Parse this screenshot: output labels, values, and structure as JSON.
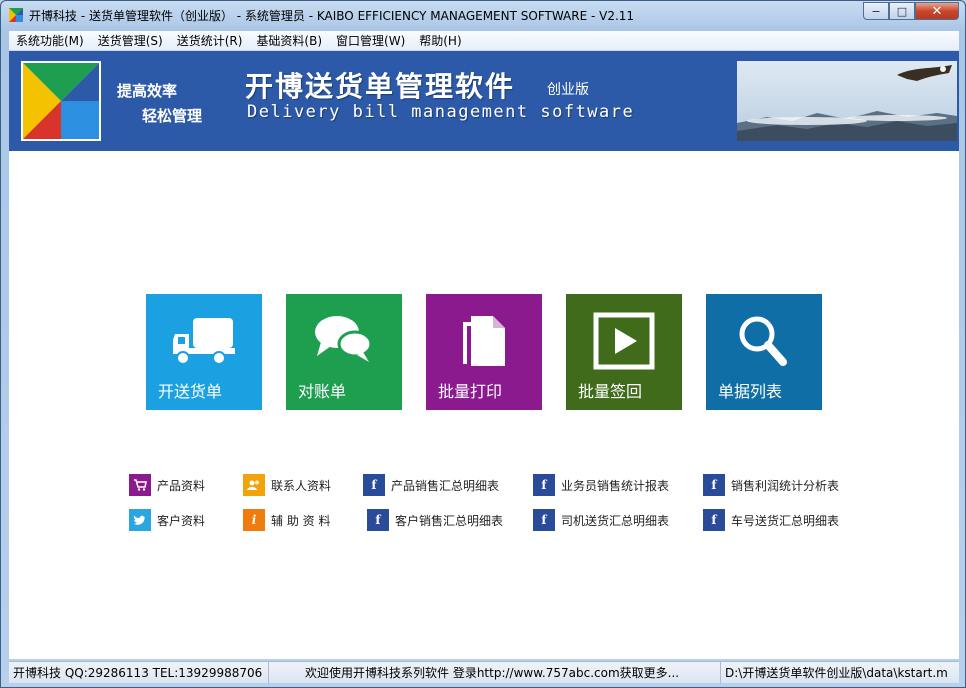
{
  "window": {
    "title": "开博科技 - 送货单管理软件（创业版） - 系统管理员 - KAIBO EFFICIENCY MANAGEMENT SOFTWARE - V2.11",
    "minimize_label": "−",
    "maximize_label": "□",
    "close_label": "✕"
  },
  "menu": [
    {
      "label": "系统功能(M)"
    },
    {
      "label": "送货管理(S)"
    },
    {
      "label": "送货统计(R)"
    },
    {
      "label": "基础资料(B)"
    },
    {
      "label": "窗口管理(W)"
    },
    {
      "label": "帮助(H)"
    }
  ],
  "banner": {
    "slogan_line1": "提高效率",
    "slogan_line2": "轻松管理",
    "title": "开博送货单管理软件",
    "edition": "创业版",
    "subtitle": "Delivery bill management software"
  },
  "tiles": [
    {
      "label": "开送货单",
      "color": "#1ba1e2",
      "icon": "truck-icon"
    },
    {
      "label": "对账单",
      "color": "#1e9e4f",
      "icon": "chat-bubbles-icon"
    },
    {
      "label": "批量打印",
      "color": "#8b1a8f",
      "icon": "documents-icon"
    },
    {
      "label": "批量签回",
      "color": "#3f6b1a",
      "icon": "play-icon"
    },
    {
      "label": "单据列表",
      "color": "#0f6ea6",
      "icon": "magnifier-icon"
    }
  ],
  "links": [
    {
      "label": "产品资料",
      "icon": "cart-icon",
      "color": "#8b1a8f"
    },
    {
      "label": "联系人资料",
      "icon": "contacts-icon",
      "color": "#f0a30a"
    },
    {
      "label": "产品销售汇总明细表",
      "icon": "facebook-icon",
      "color": "#2a4a9a"
    },
    {
      "label": "业务员销售统计报表",
      "icon": "facebook-icon",
      "color": "#2a4a9a"
    },
    {
      "label": "销售利润统计分析表",
      "icon": "facebook-icon",
      "color": "#2a4a9a"
    },
    {
      "label": "客户资料",
      "icon": "twitter-icon",
      "color": "#2ba6e1"
    },
    {
      "label": "辅 助 资 料",
      "icon": "info-icon",
      "color": "#f07c10"
    },
    {
      "label": "客户销售汇总明细表",
      "icon": "facebook-icon",
      "color": "#2a4a9a"
    },
    {
      "label": "司机送货汇总明细表",
      "icon": "facebook-icon",
      "color": "#2a4a9a"
    },
    {
      "label": "车号送货汇总明细表",
      "icon": "facebook-icon",
      "color": "#2a4a9a"
    }
  ],
  "status": {
    "company": "开博科技 QQ:29286113 TEL:13929988706",
    "welcome": "欢迎使用开博科技系列软件   登录http://www.757abc.com获取更多...",
    "path": "D:\\开博送货单软件创业版\\data\\kstart.m"
  }
}
